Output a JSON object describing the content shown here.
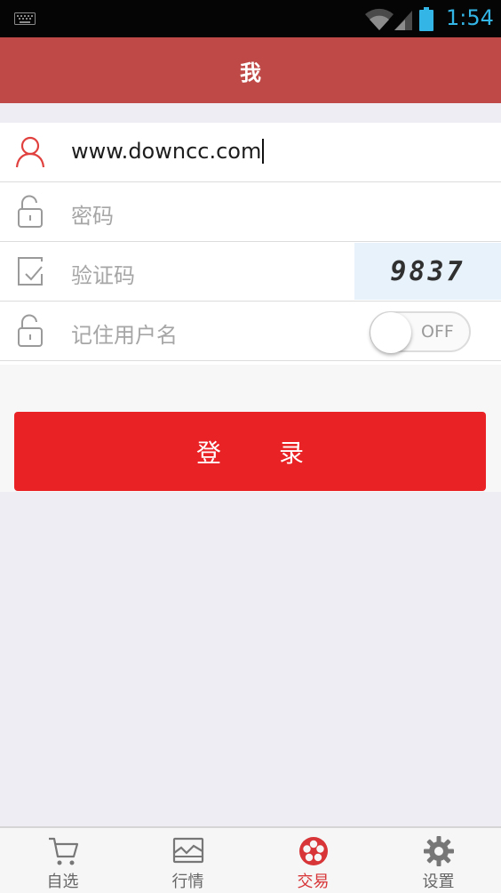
{
  "status_bar": {
    "time": "1:54"
  },
  "header": {
    "title": "我"
  },
  "form": {
    "username": {
      "value": "www.downcc.com"
    },
    "password": {
      "placeholder": "密码"
    },
    "captcha": {
      "placeholder": "验证码",
      "code": "9837"
    },
    "remember": {
      "label": "记住用户名",
      "toggle_state": "OFF"
    }
  },
  "login_button": {
    "label": "登 录"
  },
  "bottom_nav": {
    "items": [
      {
        "label": "自选",
        "icon": "cart-icon"
      },
      {
        "label": "行情",
        "icon": "market-chart-icon"
      },
      {
        "label": "交易",
        "icon": "trade-reel-icon",
        "active": true
      },
      {
        "label": "设置",
        "icon": "gear-icon"
      }
    ]
  },
  "colors": {
    "header": "#bf4946",
    "accent": "#e82225",
    "active_nav": "#d73537",
    "status_text": "#33b5e5"
  }
}
